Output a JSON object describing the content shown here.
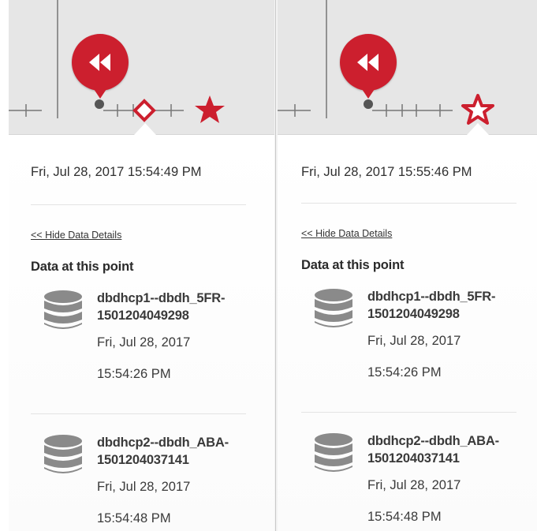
{
  "panels": [
    {
      "timestamp": "Fri, Jul 28, 2017 15:54:49 PM",
      "hide_link": "<< Hide Data Details",
      "data_heading": "Data at this point",
      "entries": [
        {
          "name_line1": "dbdhcp1--dbdh_5FR-",
          "name_line2": "1501204049298",
          "date": "Fri, Jul 28, 2017",
          "time": "15:54:26 PM",
          "icon": "database-icon"
        },
        {
          "name_line1": "dbdhcp2--dbdh_ABA-",
          "name_line2": "1501204037141",
          "date": "Fri, Jul 28, 2017",
          "time": "15:54:48 PM",
          "icon": "database-icon"
        }
      ],
      "timeline_star": "filled",
      "timeline_selected_marker": "diamond"
    },
    {
      "timestamp": "Fri, Jul 28, 2017 15:55:46 PM",
      "hide_link": "<< Hide Data Details",
      "data_heading": "Data at this point",
      "entries": [
        {
          "name_line1": "dbdhcp1--dbdh_5FR-",
          "name_line2": "1501204049298",
          "date": "Fri, Jul 28, 2017",
          "time": "15:54:26 PM",
          "icon": "database-icon"
        },
        {
          "name_line1": "dbdhcp2--dbdh_ABA-",
          "name_line2": "1501204037141",
          "date": "Fri, Jul 28, 2017",
          "time": "15:54:48 PM",
          "icon": "database-icon"
        }
      ],
      "timeline_star": "outline-selected",
      "timeline_selected_marker": "none"
    }
  ],
  "colors": {
    "accent_red": "#cc1f2e",
    "timeline_bg": "#e6e6e6",
    "db_icon": "#8a8a8a",
    "text": "#333333"
  },
  "icons": {
    "rewind": "rewind-icon",
    "star": "star-icon",
    "database": "database-icon"
  }
}
